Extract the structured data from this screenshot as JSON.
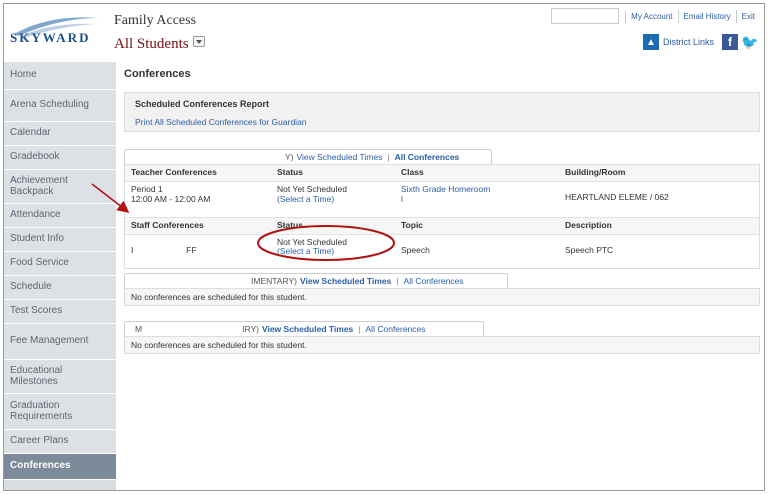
{
  "header": {
    "logo_text": "SKYWARD",
    "app_title": "Family Access",
    "students_selector": "All Students",
    "top_links": [
      "My Account",
      "Email History",
      "Exit"
    ],
    "district_links_label": "District Links"
  },
  "sidebar": {
    "items": [
      {
        "label": "Home"
      },
      {
        "label": "Arena Scheduling"
      },
      {
        "label": "Calendar"
      },
      {
        "label": "Gradebook"
      },
      {
        "label": "Achievement Backpack"
      },
      {
        "label": "Attendance"
      },
      {
        "label": "Student Info"
      },
      {
        "label": "Food Service"
      },
      {
        "label": "Schedule"
      },
      {
        "label": "Test Scores"
      },
      {
        "label": "Fee Management"
      },
      {
        "label": "Educational Milestones"
      },
      {
        "label": "Graduation Requirements"
      },
      {
        "label": "Career Plans"
      },
      {
        "label": "Conferences"
      }
    ],
    "active": "Conferences"
  },
  "main": {
    "page_title": "Conferences",
    "report": {
      "title": "Scheduled Conferences Report",
      "print_link": "Print All Scheduled Conferences for Guardian"
    },
    "schools": [
      {
        "tab_prefix": "Y)",
        "view_scheduled": "View Scheduled Times",
        "separator": "|",
        "all_conferences": "All Conferences",
        "teacher_headers": [
          "Teacher Conferences",
          "Status",
          "Class",
          "Building/Room"
        ],
        "teacher_row": {
          "period": "Period 1",
          "time": "12:00 AM - 12:00 AM",
          "status": "Not Yet Scheduled",
          "select": "(Select a Time)",
          "class": "Sixth Grade Homeroom",
          "class_sub": "l",
          "room": "HEARTLAND ELEME / 062"
        },
        "staff_headers": [
          "Staff Conferences",
          "Status",
          "Topic",
          "Description"
        ],
        "staff_row": {
          "name_start": "I",
          "name_end": "FF",
          "status": "Not Yet Scheduled",
          "select": "(Select a Time)",
          "topic": "Speech",
          "description": "Speech PTC"
        }
      },
      {
        "tab_prefix": "IMENTARY)",
        "view_scheduled": "View Scheduled Times",
        "separator": "|",
        "all_conferences": "All Conferences",
        "message": "No conferences are scheduled for this student."
      },
      {
        "tab_start": "M",
        "tab_prefix": "IRY)",
        "view_scheduled": "View Scheduled Times",
        "separator": "|",
        "all_conferences": "All Conferences",
        "message": "No conferences are scheduled for this student."
      }
    ]
  },
  "colors": {
    "link": "#2a5ea8",
    "sidebar_bg": "#dde1e5",
    "sidebar_active": "#7c8a99",
    "student_name": "#7a1010",
    "annotation": "#b01212"
  },
  "icons": [
    "skyward-logo-icon",
    "dropdown-icon",
    "district-links-icon",
    "facebook-icon",
    "twitter-icon"
  ]
}
